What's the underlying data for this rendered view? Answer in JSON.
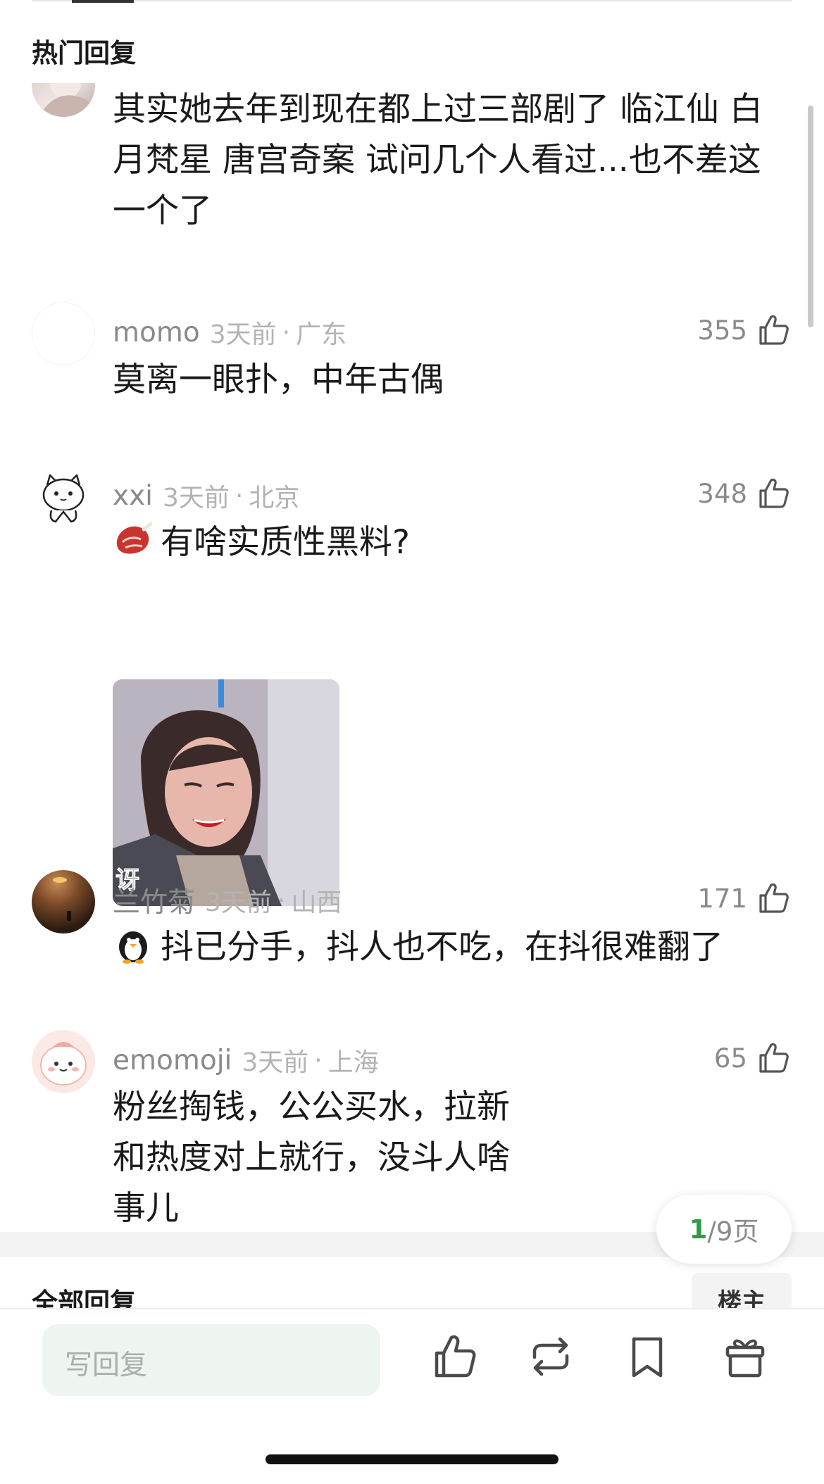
{
  "section": {
    "hot_replies": "热门回复",
    "all_replies": "全部回复",
    "owner_only": "楼主"
  },
  "comments": [
    {
      "name": "",
      "time": "",
      "location": "",
      "likes": "",
      "text": "其实她去年到现在都上过三部剧了 临江仙 白月梵星 唐宫奇案 试问几个人看过...也不差这一个了"
    },
    {
      "name": "momo",
      "time": "3天前",
      "sep": "·",
      "location": "广东",
      "likes": "355",
      "text": "莫离一眼扑，中年古偶"
    },
    {
      "name": "xxi",
      "time": "3天前",
      "sep": "·",
      "location": "北京",
      "likes": "348",
      "text": "有啥实质性黑料?",
      "emoji": "meat-emoji",
      "gif_caption": "讶"
    },
    {
      "name": "兰竹菊",
      "time": "3天前",
      "sep": "·",
      "location": "山西",
      "likes": "171",
      "text": "抖已分手，抖人也不吃，在抖很难翻了",
      "emoji": "penguin-emoji"
    },
    {
      "name": "emomoji",
      "time": "3天前",
      "sep": "·",
      "location": "上海",
      "likes": "65",
      "text": "粉丝掏钱，公公买水，拉新和热度对上就行，没斗人啥事儿"
    }
  ],
  "pagination": {
    "current": "1",
    "total_label": "/9页"
  },
  "bottom_bar": {
    "reply_placeholder": "写回复",
    "icons": [
      "thumbs-up-icon",
      "repost-icon",
      "bookmark-icon",
      "gift-icon"
    ]
  },
  "colors": {
    "accent_green": "#2e9c48",
    "meta_gray": "#8a8a8a",
    "light_gray": "#b3b3b3",
    "input_bg": "#eef4ef"
  }
}
